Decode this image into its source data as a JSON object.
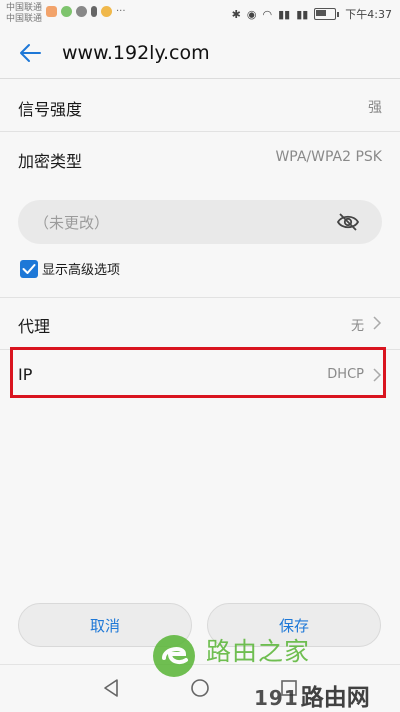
{
  "status_bar": {
    "carrier_1": "中国联通",
    "carrier_2": "中国联通",
    "dots": "···",
    "time": "下午4:37"
  },
  "app_bar": {
    "title": "www.192ly.com"
  },
  "rows": {
    "signal_label": "信号强度",
    "signal_value": "强",
    "security_label": "加密类型",
    "security_value": "WPA/WPA2 PSK"
  },
  "password": {
    "placeholder": "（未更改）"
  },
  "advanced": {
    "label": "显示高级选项",
    "checked": true
  },
  "proxy": {
    "label": "代理",
    "value": "无"
  },
  "ip": {
    "label": "IP",
    "value": "DHCP"
  },
  "buttons": {
    "cancel": "取消",
    "save": "保存"
  },
  "watermark": {
    "top_text": "路由之家",
    "bottom_num": "191",
    "bottom_text": "路由网"
  },
  "colors": {
    "accent": "#1e78d7",
    "highlight": "#d9141f",
    "watermark_green": "#58b535"
  }
}
